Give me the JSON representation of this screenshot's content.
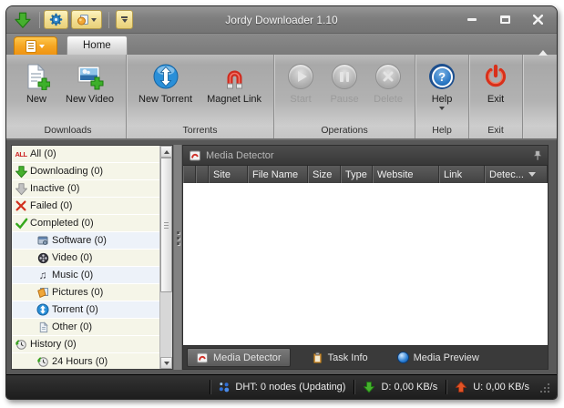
{
  "window": {
    "title": "Jordy Downloader 1.10"
  },
  "icons": {
    "all_glyph": "ALL",
    "music_glyph": "♫",
    "help_glyph": "?"
  },
  "colors": {
    "accent_orange": "#f5a623",
    "qat_yellow": "#f3e096",
    "success_green": "#46b02e",
    "alert_red": "#d9301a",
    "torrent_blue": "#2a8fd8",
    "titlebar_gray": "#7e7e7e",
    "panel_dark": "#3a3a3a",
    "statusbar_dark": "#1d1d1d",
    "sidebar_cream": "#f5f5e8"
  },
  "ribbon": {
    "tabs": [
      {
        "label": "Home",
        "active": true
      }
    ],
    "groups": [
      {
        "label": "Downloads",
        "buttons": [
          {
            "label": "New",
            "icon": "new-document-icon",
            "enabled": true
          },
          {
            "label": "New Video",
            "icon": "new-video-icon",
            "enabled": true
          }
        ]
      },
      {
        "label": "Torrents",
        "buttons": [
          {
            "label": "New Torrent",
            "icon": "torrent-icon",
            "enabled": true
          },
          {
            "label": "Magnet Link",
            "icon": "magnet-icon",
            "enabled": true
          }
        ]
      },
      {
        "label": "Operations",
        "buttons": [
          {
            "label": "Start",
            "icon": "play-icon",
            "enabled": false
          },
          {
            "label": "Pause",
            "icon": "pause-icon",
            "enabled": false
          },
          {
            "label": "Delete",
            "icon": "delete-x-icon",
            "enabled": false
          }
        ]
      },
      {
        "label": "Help",
        "buttons": [
          {
            "label": "Help",
            "icon": "help-icon",
            "enabled": true,
            "has_dropdown": true
          }
        ]
      },
      {
        "label": "Exit",
        "buttons": [
          {
            "label": "Exit",
            "icon": "power-icon",
            "enabled": true
          }
        ]
      }
    ]
  },
  "sidebar": {
    "items": [
      {
        "label": "All (0)",
        "icon": "all-icon",
        "level": 0
      },
      {
        "label": "Downloading (0)",
        "icon": "download-arrow-icon",
        "level": 0
      },
      {
        "label": "Inactive (0)",
        "icon": "inactive-arrow-icon",
        "level": 0
      },
      {
        "label": "Failed (0)",
        "icon": "failed-x-icon",
        "level": 0
      },
      {
        "label": "Completed (0)",
        "icon": "check-icon",
        "level": 0
      },
      {
        "label": "Software (0)",
        "icon": "software-icon",
        "level": 1
      },
      {
        "label": "Video (0)",
        "icon": "film-reel-icon",
        "level": 1
      },
      {
        "label": "Music (0)",
        "icon": "music-note-icon",
        "level": 1
      },
      {
        "label": "Pictures (0)",
        "icon": "pictures-icon",
        "level": 1
      },
      {
        "label": "Torrent (0)",
        "icon": "torrent-small-icon",
        "level": 1
      },
      {
        "label": "Other (0)",
        "icon": "document-icon",
        "level": 1
      },
      {
        "label": "History (0)",
        "icon": "history-clock-icon",
        "level": 0
      },
      {
        "label": "24 Hours (0)",
        "icon": "history-clock-icon",
        "level": 1
      }
    ]
  },
  "panel": {
    "title": "Media Detector",
    "table": {
      "columns": [
        "Site",
        "File Name",
        "Size",
        "Type",
        "Website",
        "Link",
        "Detec..."
      ],
      "sort_column": "Detec...",
      "sort_direction": "desc",
      "rows": []
    },
    "tabs": [
      {
        "label": "Media Detector",
        "icon": "media-detector-icon",
        "active": true
      },
      {
        "label": "Task Info",
        "icon": "task-info-icon",
        "active": false
      },
      {
        "label": "Media Preview",
        "icon": "media-preview-icon",
        "active": false
      }
    ]
  },
  "status_bar": {
    "dht": "DHT: 0 nodes (Updating)",
    "download": "D: 0,00 KB/s",
    "upload": "U: 0,00 KB/s"
  }
}
